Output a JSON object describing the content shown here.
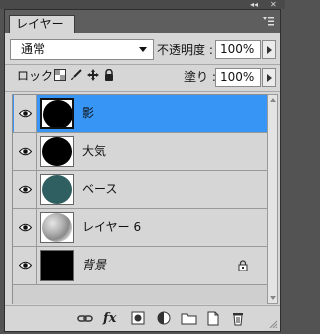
{
  "window": {
    "collapse_glyph": "◂◂",
    "close_glyph": "✕"
  },
  "panel": {
    "tab_label": "レイヤー",
    "menu_icon": "panel-menu-icon"
  },
  "options": {
    "blend_mode": "通常",
    "opacity_label": "不透明度 :",
    "opacity_value": "100%",
    "lock_label": "ロック :",
    "fill_label": "塗り :",
    "fill_value": "100%"
  },
  "layers": [
    {
      "name": "影",
      "selected": true,
      "thumb": "black-circle",
      "visible": true
    },
    {
      "name": "大気",
      "selected": false,
      "thumb": "black-circle",
      "visible": true
    },
    {
      "name": "ベース",
      "selected": false,
      "thumb": "teal-circle",
      "visible": true
    },
    {
      "name": "レイヤー 6",
      "selected": false,
      "thumb": "textured-circle",
      "visible": true
    },
    {
      "name": "背景",
      "selected": false,
      "thumb": "black-fill",
      "visible": true,
      "locked": true
    }
  ],
  "footer": {
    "fx_label": "fx",
    "buttons": [
      "link-layers-icon",
      "fx-icon",
      "add-mask-icon",
      "adjustment-layer-icon",
      "new-group-icon",
      "new-layer-icon",
      "delete-icon"
    ]
  },
  "colors": {
    "selection": "#3795f5",
    "panel_bg": "#d6d6d6",
    "teal_thumb": "#2f5f61"
  }
}
